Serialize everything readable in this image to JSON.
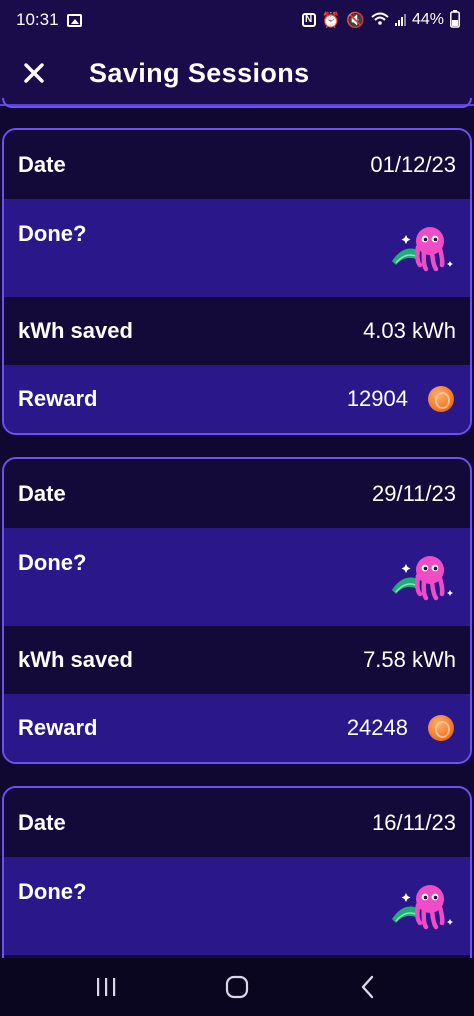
{
  "status_bar": {
    "time": "10:31",
    "battery": "44%"
  },
  "header": {
    "title": "Saving Sessions",
    "close_icon": "close-icon"
  },
  "sessions": [
    {
      "date_label": "Date",
      "date": "01/12/23",
      "done_label": "Done?",
      "done_icon": "octopus-mascot-icon",
      "kwh_label": "kWh saved",
      "kwh": "4.03 kWh",
      "reward_label": "Reward",
      "reward": "12904",
      "reward_icon": "coin-icon"
    },
    {
      "date_label": "Date",
      "date": "29/11/23",
      "done_label": "Done?",
      "done_icon": "octopus-mascot-icon",
      "kwh_label": "kWh saved",
      "kwh": "7.58 kWh",
      "reward_label": "Reward",
      "reward": "24248",
      "reward_icon": "coin-icon"
    },
    {
      "date_label": "Date",
      "date": "16/11/23",
      "done_label": "Done?",
      "done_icon": "octopus-mascot-icon"
    }
  ],
  "colors": {
    "background": "#100830",
    "card_border": "#6b52f0",
    "row_dark": "#130a3a",
    "row_light": "#2a188a",
    "mascot_pink": "#f04cc8",
    "coin_orange": "#f07a2a"
  }
}
